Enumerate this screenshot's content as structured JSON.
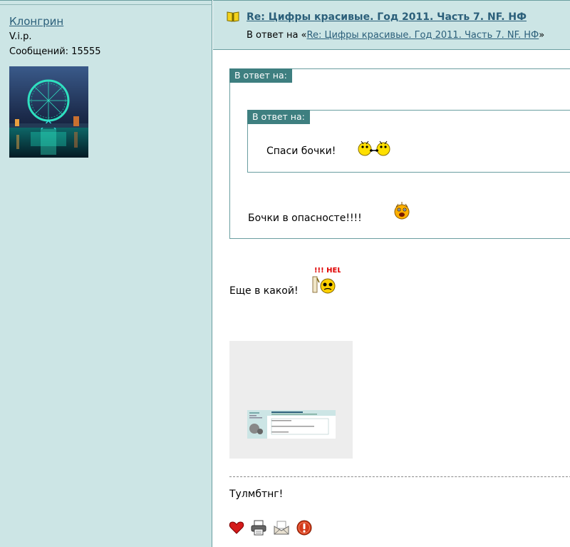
{
  "author": {
    "name": "Клонгрин",
    "rank": "V.i.p.",
    "posts_label": "Сообщений:",
    "posts_count": "15555"
  },
  "post": {
    "title": "Re: Цифры красивые. Год 2011. Часть 7. NF. НФ",
    "reply_prefix": "В ответ на «",
    "reply_link": "Re: Цифры красивые. Год 2011. Часть 7. NF. НФ",
    "reply_suffix": "»"
  },
  "quotes": {
    "outer_label": "В ответ на:",
    "inner_label": "В ответ на:",
    "inner_text": "Спаси бочки!",
    "outer_text": "Бочки в опасносте!!!!"
  },
  "body": {
    "text": "Еще в какой!",
    "help_smiley_text": "!!! HEL"
  },
  "signature": "Тулмбтнг!",
  "icons": [
    "book-icon",
    "heart-icon",
    "printer-icon",
    "mail-icon",
    "alert-icon"
  ],
  "colors": {
    "sidebar_bg": "#cce5e5",
    "link": "#2b5f7a",
    "quote_label_bg": "#3e7f80",
    "border": "#6a9ea0"
  }
}
